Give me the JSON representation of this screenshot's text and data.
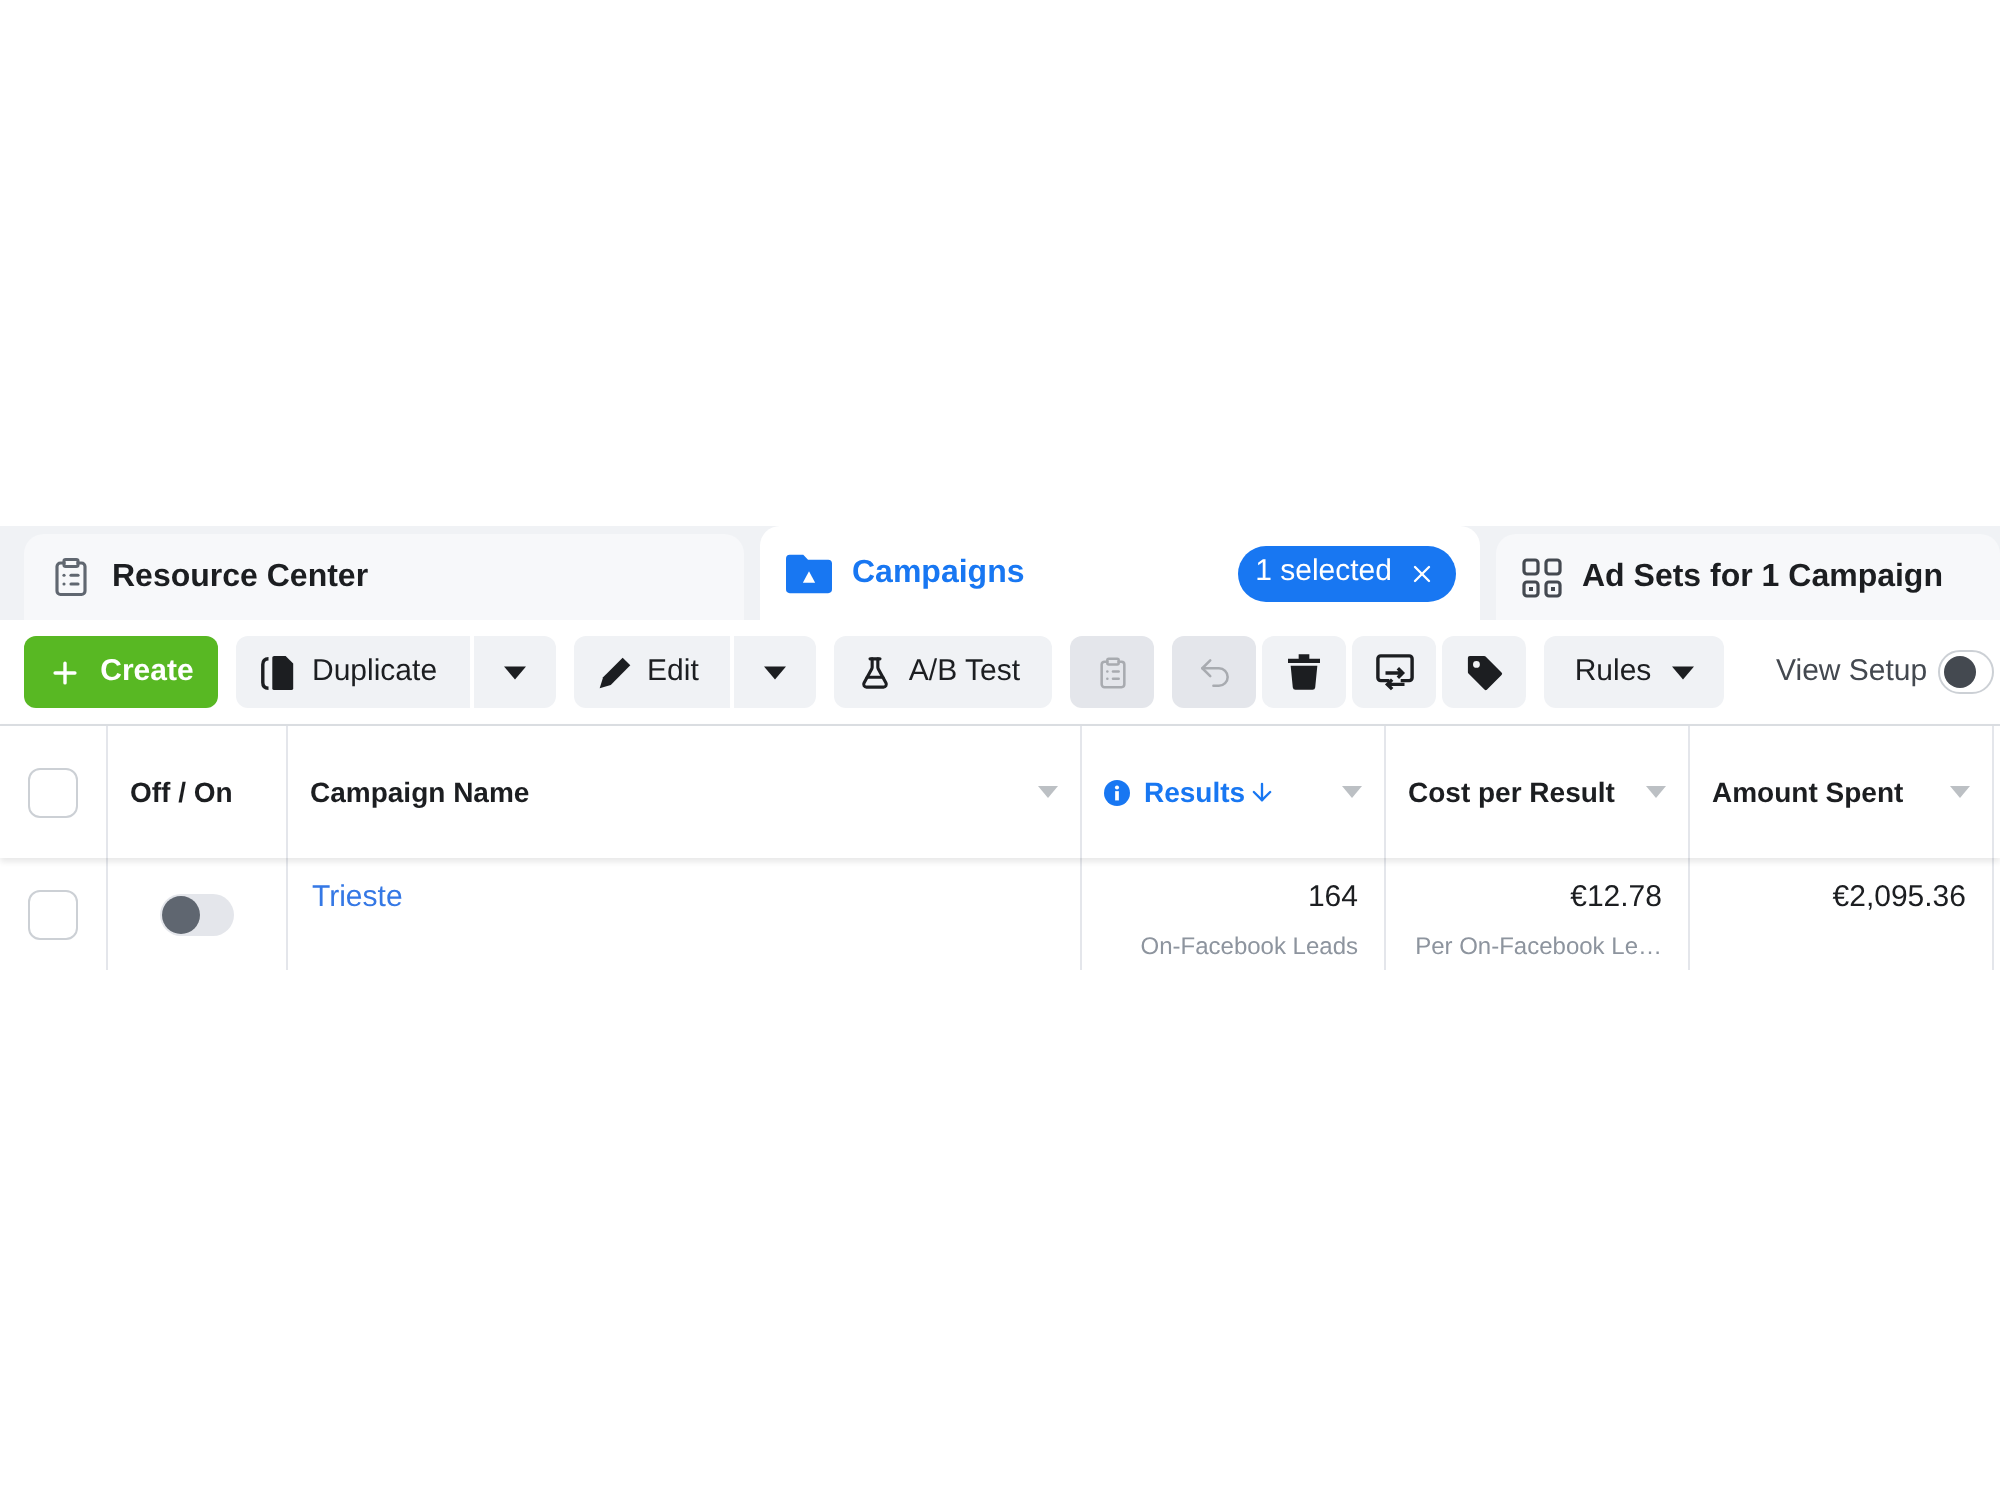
{
  "tabs": [
    {
      "kind": "resources",
      "label": "Resource Center",
      "selected": false
    },
    {
      "kind": "campaigns",
      "label": "Campaigns",
      "selected": true,
      "badge": "1 selected"
    },
    {
      "kind": "ad_sets",
      "label": "Ad Sets for 1 Campaign",
      "selected": false
    }
  ],
  "toolbar": {
    "create": {
      "label": "Create"
    },
    "actions": [
      {
        "kind": "duplicate",
        "label": "Duplicate",
        "menu": true
      },
      {
        "kind": "edit",
        "label": "Edit",
        "menu": true
      },
      {
        "kind": "ab_test",
        "label": "A/B Test",
        "menu": false
      }
    ],
    "icon_groups": [
      [
        {
          "kind": "paste",
          "disabled": true
        }
      ],
      [
        {
          "kind": "undo",
          "disabled": true
        },
        {
          "kind": "delete",
          "disabled": false
        },
        {
          "kind": "swap",
          "disabled": false
        },
        {
          "kind": "tag",
          "disabled": false
        }
      ]
    ],
    "rules": {
      "label": "Rules"
    },
    "view_setup": {
      "label": "View Setup",
      "on": false
    }
  },
  "table": {
    "select_all": {
      "checked": false
    },
    "columns": [
      {
        "kind": "toggle",
        "label": "Off / On",
        "sorted": false
      },
      {
        "kind": "text",
        "label": "Campaign Name",
        "sorted": false
      },
      {
        "kind": "number",
        "label": "Results",
        "sorted": true
      },
      {
        "kind": "number",
        "label": "Cost per Result",
        "sorted": false
      },
      {
        "kind": "number",
        "label": "Amount Spent",
        "sorted": false
      }
    ],
    "rows": [
      {
        "checked": false,
        "cells": [
          {
            "on": false
          },
          {
            "text": "Trieste"
          },
          {
            "text": "164",
            "note": "On-Facebook Leads"
          },
          {
            "text": "€12.78",
            "note": "Per On-Facebook Le…"
          },
          {
            "text": "€2,095.36"
          }
        ]
      }
    ]
  }
}
